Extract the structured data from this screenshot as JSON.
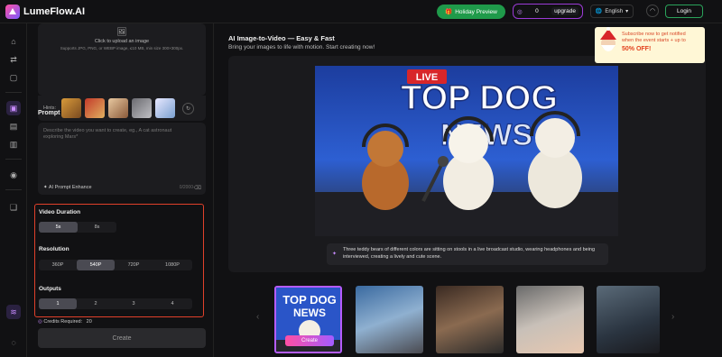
{
  "brand": {
    "name": "LumeFlow.AI"
  },
  "header": {
    "holiday_label": "Holiday Preview",
    "credits_count": "0",
    "upgrade_label": "upgrade",
    "language": "English",
    "login_label": "Login"
  },
  "promo": {
    "line1": "Subscribe now to get notified",
    "line2": "when the event starts + up to",
    "offer": "50% OFF!"
  },
  "upload": {
    "title": "Click to upload an image",
    "formats": "Supports JPG, PNG, or WEBP image, ≤10 MB, min size 300×300px.",
    "hints_label": "Hints:"
  },
  "prompt": {
    "title": "Prompt",
    "placeholder": "Describe the video you want to create, eg., A cat astronaut exploring Mars*",
    "enhance_label": "AI Prompt Enhance",
    "count": "0/2000"
  },
  "duration": {
    "title": "Video Duration",
    "options": [
      "5s",
      "8s"
    ],
    "selected": "5s"
  },
  "resolution": {
    "title": "Resolution",
    "options": [
      "360P",
      "540P",
      "720P",
      "1080P"
    ],
    "selected": "540P"
  },
  "outputs": {
    "title": "Outputs",
    "options": [
      "1",
      "2",
      "3",
      "4"
    ],
    "selected": "1"
  },
  "credits_required": {
    "label": "Credits Required:",
    "value": "20"
  },
  "create_label": "Create",
  "main": {
    "title": "AI Image-to-Video — Easy & Fast",
    "subtitle": "Bring your images to life with motion. Start creating now!",
    "video_text": {
      "live": "LIVE",
      "headline1": "TOP DOG",
      "headline2": "NEWS"
    },
    "caption": "Three teddy bears of different colors are sitting on stools in a live broadcast studio, wearing headphones and being interviewed, creating a lively and cute scene."
  },
  "carousel": {
    "create_overlay": "Create",
    "card1": {
      "headline1": "TOP DOG",
      "headline2": "NEWS"
    }
  },
  "colors": {
    "accent": "#b55cff",
    "highlight_border": "#e0402a",
    "login_border": "#2aa35a"
  }
}
